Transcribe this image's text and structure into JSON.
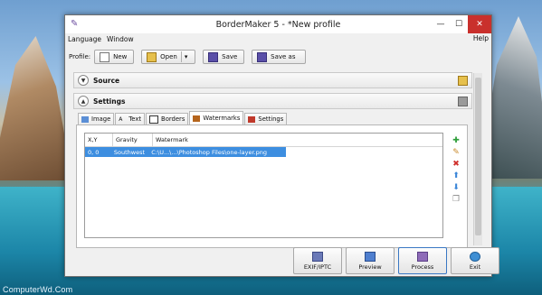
{
  "window": {
    "title": "BorderMaker 5 - *New profile"
  },
  "menu": {
    "items": [
      "Language",
      "Window"
    ],
    "help": "Help"
  },
  "toolbar": {
    "profile_label": "Profile:",
    "new_label": "New",
    "open_label": "Open",
    "save_label": "Save",
    "save_as_label": "Save as"
  },
  "sections": {
    "source": "Source",
    "settings": "Settings"
  },
  "tabs": [
    "Image",
    "Text",
    "Borders",
    "Watermarks",
    "Settings"
  ],
  "tabs_active": "Watermarks",
  "watermarks_table": {
    "columns": [
      "X,Y",
      "Gravity",
      "Watermark"
    ],
    "rows": [
      {
        "xy": "0, 0",
        "gravity": "Southwest",
        "watermark": "C:\\U...\\...\\Photoshop Files\\one-layer.png",
        "selected": true
      }
    ]
  },
  "actions": {
    "exif_label": "EXIF/IPTC",
    "preview_label": "Preview",
    "process_label": "Process",
    "exit_label": "Exit"
  },
  "desktop": {
    "watermark_text": "ComputerWd.Com"
  },
  "colors": {
    "selection": "#3d8ee0",
    "close_button": "#c9302c",
    "accent": "#3a78c4"
  }
}
